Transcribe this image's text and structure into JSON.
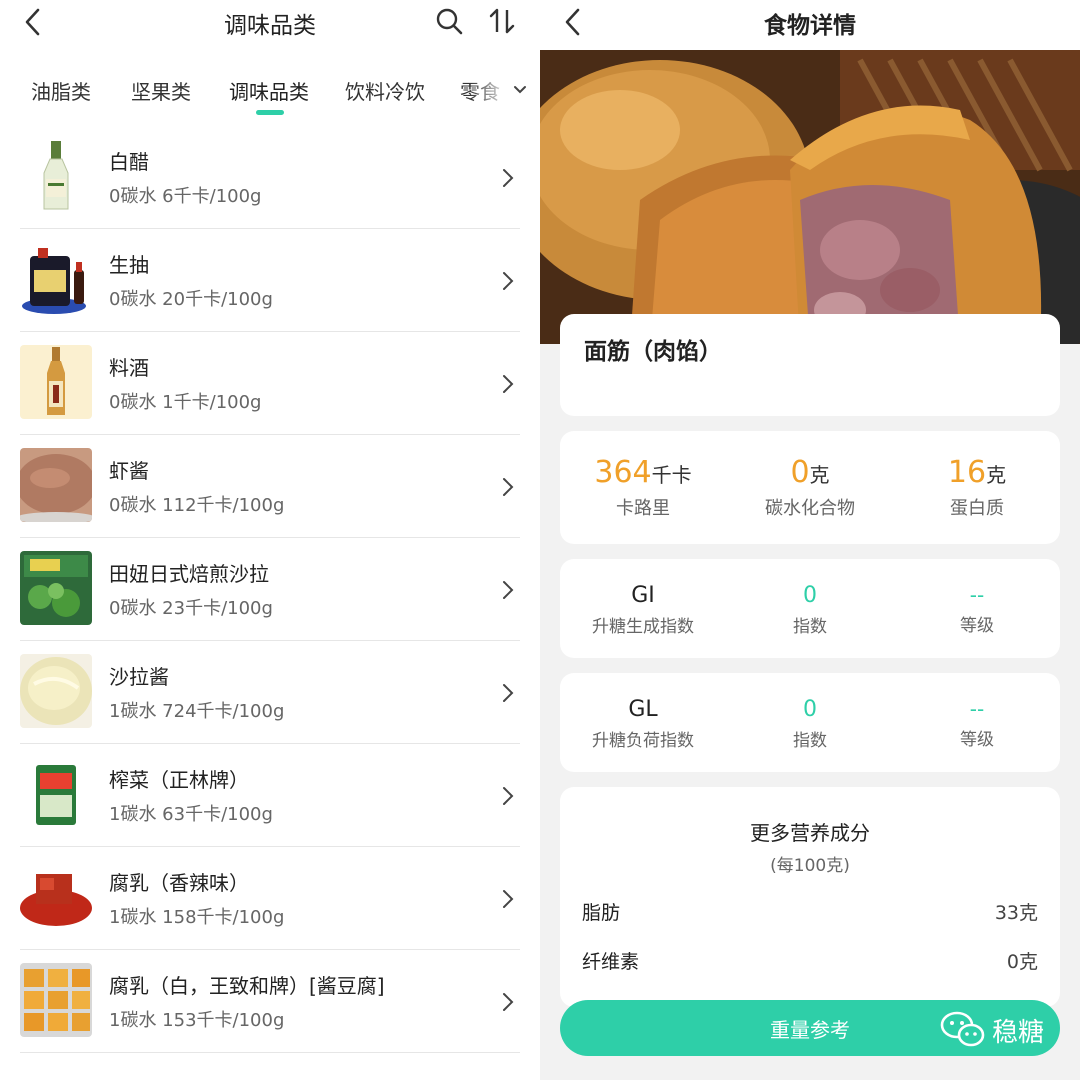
{
  "left": {
    "header": {
      "title": "调味品类"
    },
    "tabs": [
      {
        "label": "油脂类"
      },
      {
        "label": "坚果类"
      },
      {
        "label": "调味品类"
      },
      {
        "label": "饮料冷饮"
      },
      {
        "label": "零食"
      }
    ],
    "active_tab": "调味品类",
    "items": [
      {
        "name": "白醋",
        "sub": "0碳水  6千卡/100g",
        "thumb": "vinegar-bottle"
      },
      {
        "name": "生抽",
        "sub": "0碳水  20千卡/100g",
        "thumb": "soy-sauce-jug"
      },
      {
        "name": "料酒",
        "sub": "0碳水  1千卡/100g",
        "thumb": "cooking-wine-bottle"
      },
      {
        "name": "虾酱",
        "sub": "0碳水  112千卡/100g",
        "thumb": "shrimp-paste"
      },
      {
        "name": "田妞日式焙煎沙拉",
        "sub": "0碳水  23千卡/100g",
        "thumb": "salad-bag"
      },
      {
        "name": "沙拉酱",
        "sub": "1碳水  724千卡/100g",
        "thumb": "mayonnaise"
      },
      {
        "name": "榨菜（正林牌）",
        "sub": "1碳水  63千卡/100g",
        "thumb": "pickle-pack"
      },
      {
        "name": "腐乳（香辣味）",
        "sub": "1碳水  158千卡/100g",
        "thumb": "spicy-tofu"
      },
      {
        "name": "腐乳（白，王致和牌）[酱豆腐]",
        "sub": "1碳水  153千卡/100g",
        "thumb": "white-tofu"
      }
    ]
  },
  "right": {
    "header": {
      "title": "食物详情"
    },
    "food_name": "面筋（肉馅）",
    "stats": [
      {
        "value": "364",
        "unit": "千卡",
        "label": "卡路里"
      },
      {
        "value": "0",
        "unit": "克",
        "label": "碳水化合物"
      },
      {
        "value": "16",
        "unit": "克",
        "label": "蛋白质"
      }
    ],
    "gi": {
      "name": "GI",
      "name_label": "升糖生成指数",
      "index": "0",
      "index_label": "指数",
      "level": "--",
      "level_label": "等级"
    },
    "gl": {
      "name": "GL",
      "name_label": "升糖负荷指数",
      "index": "0",
      "index_label": "指数",
      "level": "--",
      "level_label": "等级"
    },
    "nutrition": {
      "title": "更多营养成分",
      "subtitle": "(每100克)",
      "rows": [
        {
          "name": "脂肪",
          "value": "33克"
        },
        {
          "name": "纤维素",
          "value": "0克"
        }
      ]
    },
    "bottom_button": "重量参考",
    "watermark": "稳糖"
  },
  "colors": {
    "accent": "#2ecfa8",
    "calorie": "#f0a029"
  }
}
